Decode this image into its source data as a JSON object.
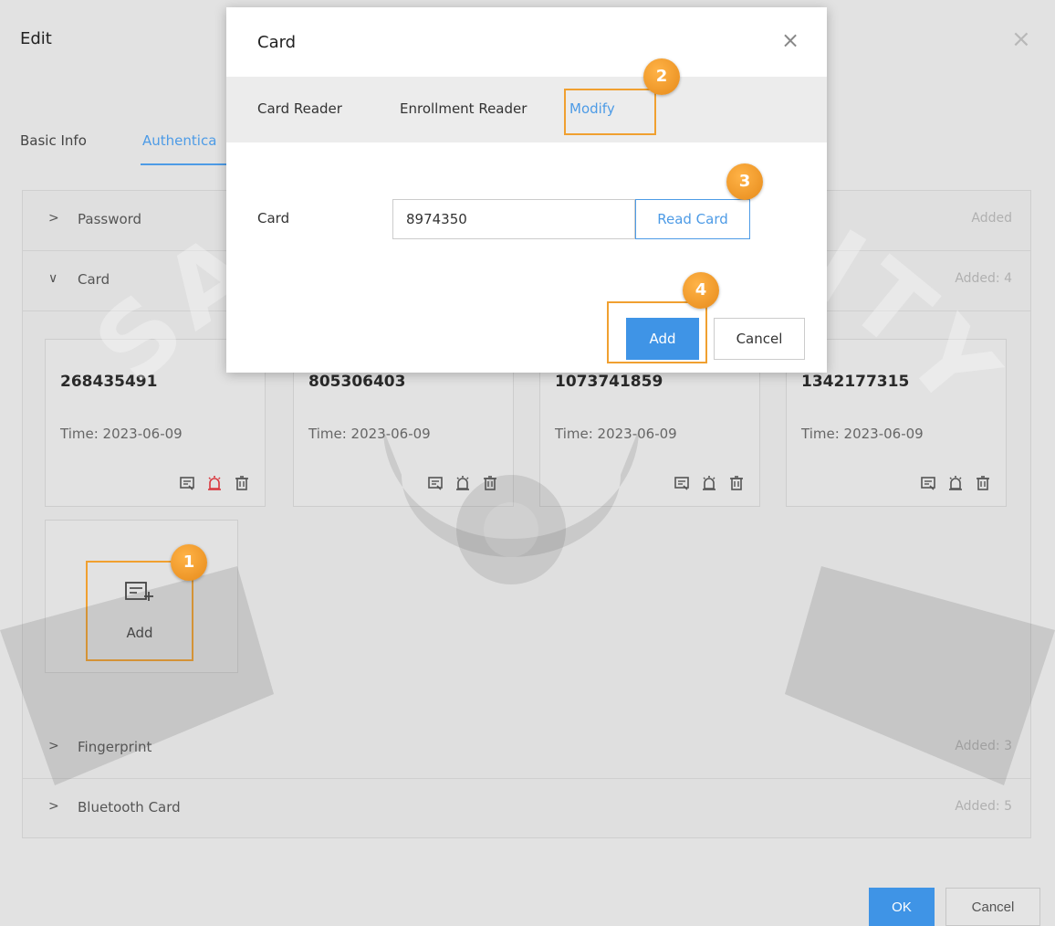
{
  "edit": {
    "title": "Edit",
    "close": "×",
    "tabs": [
      {
        "label": "Basic Info"
      },
      {
        "label": "Authentica"
      }
    ],
    "sections": [
      {
        "label": "Password",
        "chevron": ">",
        "status": "Added"
      },
      {
        "label": "Card",
        "chevron": "∨",
        "status": "Added: 4"
      },
      {
        "label": "Fingerprint",
        "chevron": ">",
        "status": "Added: 3"
      },
      {
        "label": "Bluetooth Card",
        "chevron": ">",
        "status": "Added: 5"
      }
    ],
    "cards": [
      {
        "number": "268435491",
        "time": "Time: 2023-06-09"
      },
      {
        "number": "805306403",
        "time": "Time: 2023-06-09"
      },
      {
        "number": "1073741859",
        "time": "Time: 2023-06-09"
      },
      {
        "number": "1342177315",
        "time": "Time: 2023-06-09"
      }
    ],
    "add_label": "Add",
    "ok_label": "OK",
    "cancel_label": "Cancel"
  },
  "modal": {
    "title": "Card",
    "close": "×",
    "tabs": [
      {
        "label": "Card Reader"
      },
      {
        "label": "Enrollment Reader"
      },
      {
        "label": "Modify"
      }
    ],
    "field_label": "Card",
    "card_value": "8974350",
    "read_card_label": "Read Card",
    "add_label": "Add",
    "cancel_label": "Cancel"
  },
  "badges": [
    "1",
    "2",
    "3",
    "4"
  ],
  "colors": {
    "accent": "#3f94e6",
    "highlight": "#f0a030",
    "alarm": "#d9383f"
  },
  "watermark": "SAM SECURITY"
}
